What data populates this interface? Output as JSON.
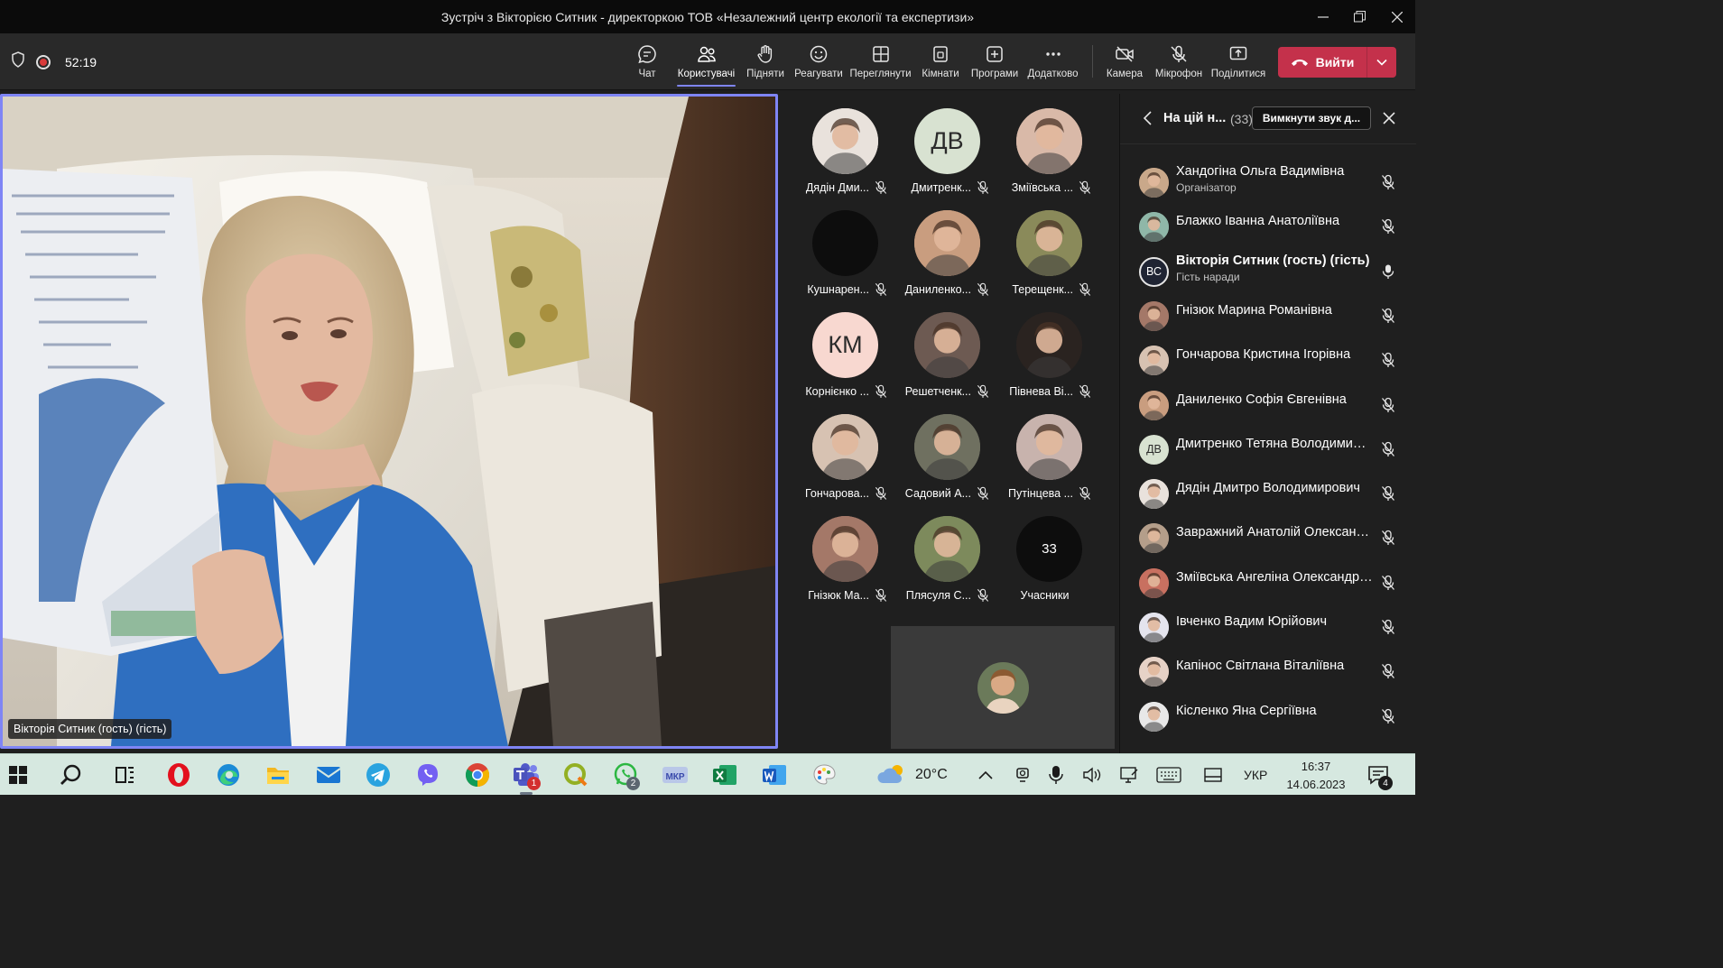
{
  "window": {
    "title": "Зустріч з Вікторією Ситник - директоркою ТОВ «Незалежний центр екології та експертизи»",
    "controls": [
      "minimize-icon",
      "restore-icon",
      "close-icon"
    ]
  },
  "meeting_bar": {
    "timer": "52:19",
    "buttons": {
      "chat": "Чат",
      "people": "Користувачі",
      "raise": "Підняти",
      "react": "Реагувати",
      "view": "Переглянути",
      "rooms": "Кімнати",
      "apps": "Програми",
      "more": "Додатково",
      "camera": "Камера",
      "mic": "Мікрофон",
      "share": "Поділитися"
    },
    "leave_label": "Вийти",
    "accent": "#7f85f5",
    "leave_color": "#c4314b"
  },
  "stage": {
    "speaker_name": "Вікторія Ситник (гость) (гість)"
  },
  "gallery": {
    "tiles": [
      {
        "name": "Дядін Дми...",
        "initials": "",
        "bg": "#e9e2dc",
        "photo": true
      },
      {
        "name": "Дмитренк...",
        "initials": "ДВ",
        "bg": "#d8e2d1",
        "photo": false
      },
      {
        "name": "Зміївська ...",
        "initials": "",
        "bg": "#d9b9a8",
        "photo": true
      },
      {
        "name": "Кушнарен...",
        "initials": "",
        "bg": "#0d0d0d",
        "photo": false
      },
      {
        "name": "Даниленко...",
        "initials": "",
        "bg": "#c99d7f",
        "photo": true
      },
      {
        "name": "Терещенк...",
        "initials": "",
        "bg": "#8a8a5a",
        "photo": true
      },
      {
        "name": "Корнієнко ...",
        "initials": "КМ",
        "bg": "#f8d8d0",
        "photo": false
      },
      {
        "name": "Решетченк...",
        "initials": "",
        "bg": "#6d5a52",
        "photo": true
      },
      {
        "name": "Півнева Ві...",
        "initials": "",
        "bg": "#2a2320",
        "photo": true
      },
      {
        "name": "Гончарова...",
        "initials": "",
        "bg": "#d7c2b2",
        "photo": true
      },
      {
        "name": "Садовий А...",
        "initials": "",
        "bg": "#6f7060",
        "photo": true
      },
      {
        "name": "Путінцева ...",
        "initials": "",
        "bg": "#c8b3ad",
        "photo": true
      },
      {
        "name": "Гнізюк Ма...",
        "initials": "",
        "bg": "#a47868",
        "photo": true
      },
      {
        "name": "Плясуля С...",
        "initials": "",
        "bg": "#7d8a5c",
        "photo": true
      }
    ],
    "overflow": {
      "count": "33",
      "label": "Учасники"
    }
  },
  "participants_panel": {
    "title": "На цій н...",
    "count": "(33)",
    "mute_all": "Вимкнути звук д...",
    "rows": [
      {
        "name": "Хандогіна Ольга Вадимівна",
        "role": "Організатор",
        "initials": "",
        "bg": "#c9a88a",
        "mic": "muted"
      },
      {
        "name": "Блажко Іванна Анатоліївна",
        "role": "",
        "initials": "",
        "bg": "#8fb7a8",
        "mic": "muted"
      },
      {
        "name": "Вікторія Ситник (гость) (гість)",
        "role": "Гість наради",
        "initials": "ВС",
        "bg": "#1f2433",
        "mic": "on"
      },
      {
        "name": "Гнізюк Марина Романівна",
        "role": "",
        "initials": "",
        "bg": "#a47868",
        "mic": "muted"
      },
      {
        "name": "Гончарова Кристина Ігорівна",
        "role": "",
        "initials": "",
        "bg": "#d7c2b2",
        "mic": "muted"
      },
      {
        "name": "Даниленко Софія Євгенівна",
        "role": "",
        "initials": "",
        "bg": "#c99d7f",
        "mic": "muted"
      },
      {
        "name": "Дмитренко Тетяна Володимирі...",
        "role": "",
        "initials": "ДВ",
        "bg": "#d8e2d1",
        "mic": "muted"
      },
      {
        "name": "Дядін Дмитро Володимирович",
        "role": "",
        "initials": "",
        "bg": "#e9e2dc",
        "mic": "muted"
      },
      {
        "name": "Завражний Анатолій Олександ...",
        "role": "",
        "initials": "",
        "bg": "#b49e8a",
        "mic": "muted"
      },
      {
        "name": "Зміївська Ангеліна Олександрі...",
        "role": "",
        "initials": "",
        "bg": "#c87060",
        "mic": "muted"
      },
      {
        "name": "Івченко Вадим Юрійович",
        "role": "",
        "initials": "",
        "bg": "#e4e4ee",
        "mic": "muted"
      },
      {
        "name": "Капінос Світлана Віталіївна",
        "role": "",
        "initials": "",
        "bg": "#e6d2c7",
        "mic": "muted"
      },
      {
        "name": "Кісленко Яна Сергіївна",
        "role": "",
        "initials": "",
        "bg": "#e8e8e8",
        "mic": "muted"
      }
    ]
  },
  "taskbar": {
    "apps": [
      "windows-start-icon",
      "search-icon",
      "task-view-icon",
      "opera-icon",
      "edge-icon",
      "file-explorer-icon",
      "mail-icon",
      "telegram-icon",
      "viber-icon",
      "chrome-icon",
      "teams-icon",
      "qgis-icon",
      "whatsapp-icon",
      "mkp-icon",
      "excel-icon",
      "word-icon",
      "paint-icon"
    ],
    "teams_badge": "1",
    "whatsapp_badge": "2",
    "weather": "20°C",
    "language": "УКР",
    "time": "16:37",
    "date": "14.06.2023",
    "notifications": "4"
  }
}
